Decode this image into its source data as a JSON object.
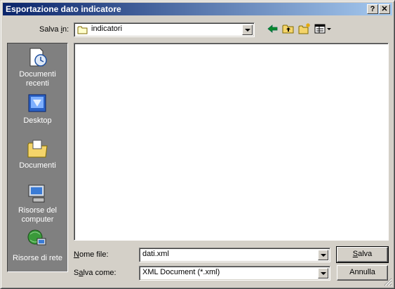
{
  "window": {
    "title": "Esportazione dato indicatore",
    "help_glyph": "?",
    "close_glyph": "✕"
  },
  "lookin": {
    "label_pre": "Salva ",
    "label_key": "i",
    "label_post": "n:",
    "value": "indicatori"
  },
  "places": [
    {
      "label": "Documenti recenti",
      "icon": "recent-documents-icon"
    },
    {
      "label": "Desktop",
      "icon": "desktop-icon"
    },
    {
      "label": "Documenti",
      "icon": "my-documents-icon"
    },
    {
      "label": "Risorse del computer",
      "icon": "my-computer-icon"
    },
    {
      "label": "Risorse di rete",
      "icon": "network-places-icon"
    }
  ],
  "filename": {
    "label_key": "N",
    "label_post": "ome file:",
    "value": "dati.xml"
  },
  "savetype": {
    "label_pre": "S",
    "label_key": "a",
    "label_post": "lva come:",
    "value": "XML Document (*.xml)"
  },
  "buttons": {
    "save_key": "S",
    "save_rest": "alva",
    "cancel": "Annulla"
  },
  "colors": {
    "title_start": "#0a246a",
    "title_end": "#a6caf0",
    "face": "#d4d0c8",
    "places_bg": "#808080"
  }
}
